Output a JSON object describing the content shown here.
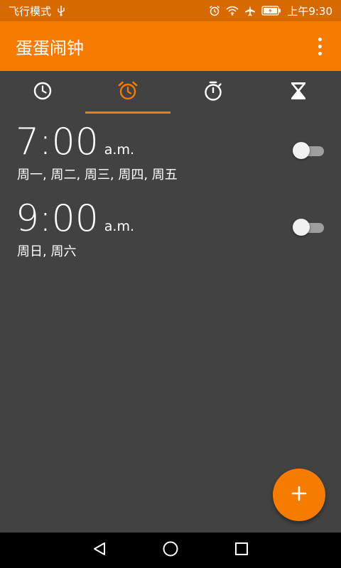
{
  "status_bar": {
    "left_text": "飞行模式",
    "time": "上午9:30",
    "icons": [
      "usb-icon",
      "alarm-icon",
      "wifi-icon",
      "airplane-icon",
      "battery-icon"
    ]
  },
  "app_bar": {
    "title": "蛋蛋闹钟",
    "menu_icon": "more-vert-icon"
  },
  "tabs": [
    {
      "name": "clock",
      "icon": "clock-icon",
      "active": false
    },
    {
      "name": "alarm",
      "icon": "alarm-icon",
      "active": true
    },
    {
      "name": "stopwatch",
      "icon": "stopwatch-icon",
      "active": false
    },
    {
      "name": "timer",
      "icon": "hourglass-icon",
      "active": false
    }
  ],
  "alarms": [
    {
      "time": "7:00",
      "ampm": "a.m.",
      "days": "周一, 周二, 周三, 周四, 周五",
      "enabled": false
    },
    {
      "time": "9:00",
      "ampm": "a.m.",
      "days": "周日, 周六",
      "enabled": false
    }
  ],
  "fab": {
    "icon": "plus-icon",
    "label": "+"
  },
  "nav_bar": {
    "buttons": [
      "back-icon",
      "home-icon",
      "recents-icon"
    ]
  },
  "colors": {
    "accent": "#f57c00",
    "status_bar": "#d66a00",
    "background": "#424242",
    "nav_bar": "#000000"
  }
}
